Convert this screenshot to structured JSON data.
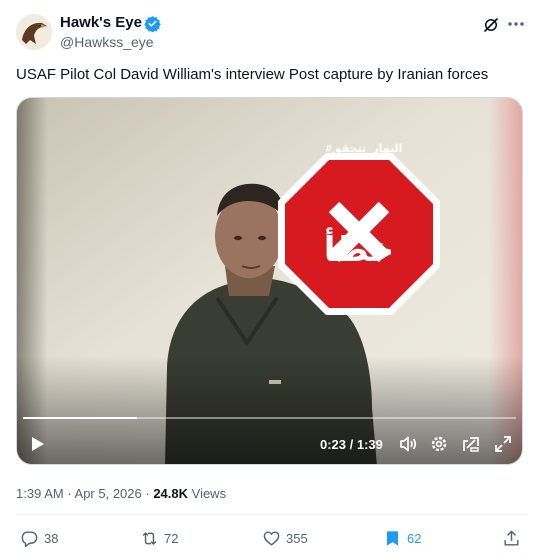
{
  "author": {
    "name": "Hawk's Eye",
    "handle": "@Hawkss_eye"
  },
  "tweet": {
    "text": "USAF Pilot Col David William's interview Post capture by Iranian forces"
  },
  "video": {
    "time": "0:23 / 1:39",
    "progress": 0.232,
    "overlay_sign": {
      "top_text": "#النهار_تتحقق",
      "bottom_text": "خطأ"
    }
  },
  "meta": {
    "timestamp": "1:39 AM · Apr 5, 2026 · ",
    "views_count": "24.8K",
    "views_label": " Views"
  },
  "actions": {
    "replies": "38",
    "reposts": "72",
    "likes": "355",
    "bookmarks": "62"
  },
  "colors": {
    "accent": "#1d9bf0",
    "muted": "#536471",
    "text": "#0f1419",
    "sign_red": "#d71920"
  },
  "icons": [
    "verified-badge-icon",
    "grok-icon",
    "more-icon",
    "play-icon",
    "volume-icon",
    "gear-icon",
    "captions-icon",
    "expand-icon",
    "reply-icon",
    "repost-icon",
    "like-icon",
    "bookmark-icon",
    "share-icon"
  ]
}
